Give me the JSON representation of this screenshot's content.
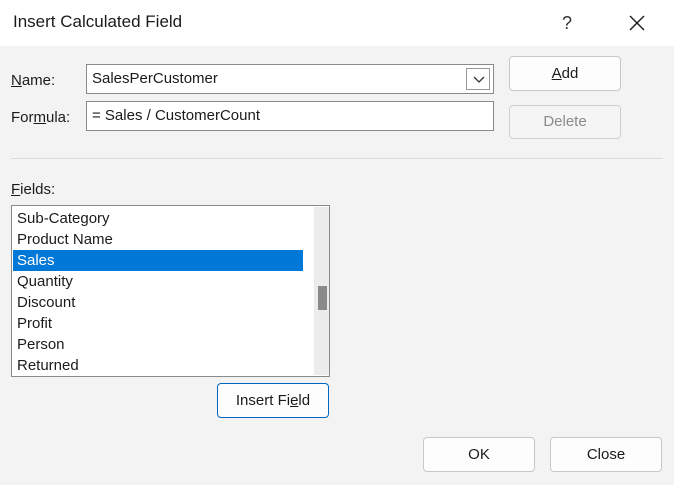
{
  "dialog": {
    "title": "Insert Calculated Field",
    "help_glyph": "?",
    "name_label_pre": "",
    "name_label_u": "N",
    "name_label_post": "ame:",
    "name_value": "SalesPerCustomer",
    "formula_label_pre": "For",
    "formula_label_u": "m",
    "formula_label_post": "ula:",
    "formula_value": "= Sales / CustomerCount",
    "add_pre": "",
    "add_u": "A",
    "add_post": "dd",
    "delete_label": "Delete",
    "fields_label_pre": "",
    "fields_label_u": "F",
    "fields_label_post": "ields:",
    "fields": [
      "Sub-Category",
      "Product Name",
      "Sales",
      "Quantity",
      "Discount",
      "Profit",
      "Person",
      "Returned"
    ],
    "selected_field": "Sales",
    "insert_field_pre": "Insert Fi",
    "insert_field_u": "e",
    "insert_field_post": "ld",
    "ok_label": "OK",
    "close_label": "Close"
  },
  "icons": {
    "close": "close-icon",
    "dropdown": "chevron-down-icon"
  },
  "colors": {
    "selection": "#0078d7",
    "default_button_border": "#0067c0"
  }
}
